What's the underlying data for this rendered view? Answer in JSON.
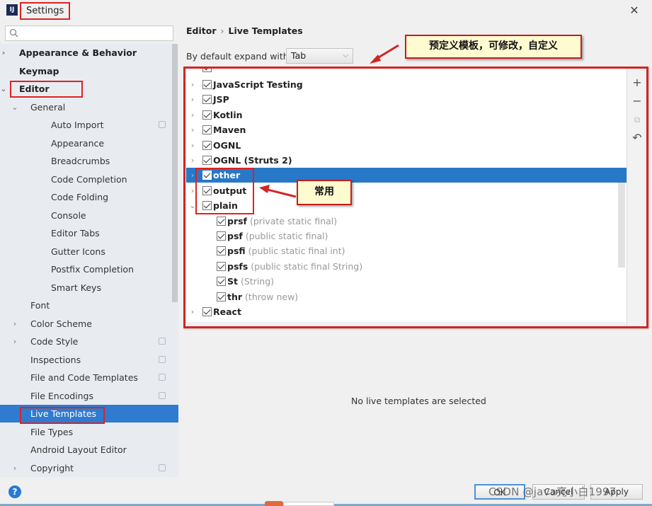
{
  "window": {
    "title": "Settings",
    "app_icon": "IJ",
    "close_icon": "close-icon"
  },
  "search": {
    "placeholder": "",
    "value": ""
  },
  "sidebar": {
    "items": [
      {
        "label": "Appearance & Behavior",
        "level": 0,
        "bold": true,
        "arrow": ">",
        "copy": false
      },
      {
        "label": "Keymap",
        "level": 0,
        "bold": true,
        "arrow": "",
        "copy": false
      },
      {
        "label": "Editor",
        "level": 0,
        "bold": true,
        "arrow": "v",
        "copy": false
      },
      {
        "label": "General",
        "level": 1,
        "bold": false,
        "arrow": "v",
        "copy": false
      },
      {
        "label": "Auto Import",
        "level": 2,
        "bold": false,
        "arrow": "",
        "copy": true
      },
      {
        "label": "Appearance",
        "level": 2,
        "bold": false,
        "arrow": "",
        "copy": false
      },
      {
        "label": "Breadcrumbs",
        "level": 2,
        "bold": false,
        "arrow": "",
        "copy": false
      },
      {
        "label": "Code Completion",
        "level": 2,
        "bold": false,
        "arrow": "",
        "copy": false
      },
      {
        "label": "Code Folding",
        "level": 2,
        "bold": false,
        "arrow": "",
        "copy": false
      },
      {
        "label": "Console",
        "level": 2,
        "bold": false,
        "arrow": "",
        "copy": false
      },
      {
        "label": "Editor Tabs",
        "level": 2,
        "bold": false,
        "arrow": "",
        "copy": false
      },
      {
        "label": "Gutter Icons",
        "level": 2,
        "bold": false,
        "arrow": "",
        "copy": false
      },
      {
        "label": "Postfix Completion",
        "level": 2,
        "bold": false,
        "arrow": "",
        "copy": false
      },
      {
        "label": "Smart Keys",
        "level": 2,
        "bold": false,
        "arrow": "",
        "copy": false
      },
      {
        "label": "Font",
        "level": 1,
        "bold": false,
        "arrow": "",
        "copy": false
      },
      {
        "label": "Color Scheme",
        "level": 1,
        "bold": false,
        "arrow": ">",
        "copy": false
      },
      {
        "label": "Code Style",
        "level": 1,
        "bold": false,
        "arrow": ">",
        "copy": true
      },
      {
        "label": "Inspections",
        "level": 1,
        "bold": false,
        "arrow": "",
        "copy": true
      },
      {
        "label": "File and Code Templates",
        "level": 1,
        "bold": false,
        "arrow": "",
        "copy": true
      },
      {
        "label": "File Encodings",
        "level": 1,
        "bold": false,
        "arrow": "",
        "copy": true
      },
      {
        "label": "Live Templates",
        "level": 1,
        "bold": false,
        "arrow": "",
        "copy": false,
        "selected": true
      },
      {
        "label": "File Types",
        "level": 1,
        "bold": false,
        "arrow": "",
        "copy": false
      },
      {
        "label": "Android Layout Editor",
        "level": 1,
        "bold": false,
        "arrow": "",
        "copy": false
      },
      {
        "label": "Copyright",
        "level": 1,
        "bold": false,
        "arrow": ">",
        "copy": true
      }
    ]
  },
  "main": {
    "breadcrumb": [
      "Editor",
      "Live Templates"
    ],
    "breadcrumb_sep": "›",
    "expand_label": "By default expand with",
    "expand_value": "Tab",
    "tree": [
      {
        "label": "JavaScript Testing",
        "desc": "",
        "level": 0,
        "arrow": ">",
        "checked": true
      },
      {
        "label": "JSP",
        "desc": "",
        "level": 0,
        "arrow": ">",
        "checked": true
      },
      {
        "label": "Kotlin",
        "desc": "",
        "level": 0,
        "arrow": ">",
        "checked": true
      },
      {
        "label": "Maven",
        "desc": "",
        "level": 0,
        "arrow": ">",
        "checked": true
      },
      {
        "label": "OGNL",
        "desc": "",
        "level": 0,
        "arrow": ">",
        "checked": true
      },
      {
        "label": "OGNL (Struts 2)",
        "desc": "",
        "level": 0,
        "arrow": ">",
        "checked": true
      },
      {
        "label": "other",
        "desc": "",
        "level": 0,
        "arrow": ">",
        "checked": true,
        "selected": true
      },
      {
        "label": "output",
        "desc": "",
        "level": 0,
        "arrow": ">",
        "checked": true
      },
      {
        "label": "plain",
        "desc": "",
        "level": 0,
        "arrow": "v",
        "checked": true
      },
      {
        "label": "prsf",
        "desc": "(private static final)",
        "level": 1,
        "arrow": "",
        "checked": true
      },
      {
        "label": "psf",
        "desc": "(public static final)",
        "level": 1,
        "arrow": "",
        "checked": true
      },
      {
        "label": "psfi",
        "desc": "(public static final int)",
        "level": 1,
        "arrow": "",
        "checked": true
      },
      {
        "label": "psfs",
        "desc": "(public static final String)",
        "level": 1,
        "arrow": "",
        "checked": true
      },
      {
        "label": "St",
        "desc": "(String)",
        "level": 1,
        "arrow": "",
        "checked": true
      },
      {
        "label": "thr",
        "desc": "(throw new)",
        "level": 1,
        "arrow": "",
        "checked": true
      },
      {
        "label": "React",
        "desc": "",
        "level": 0,
        "arrow": ">",
        "checked": true
      }
    ],
    "toolbar": {
      "add": "+",
      "remove": "−",
      "copy": "⧉",
      "restore": "↶"
    },
    "empty_message": "No live templates are selected"
  },
  "annotations": {
    "predefined": "预定义模板，可修改，自定义",
    "common": "常用",
    "annotation_color": "#d42424",
    "callout_bg": "#fffbd0"
  },
  "footer": {
    "help": "?",
    "buttons": [
      "OK",
      "Cancel",
      "Apply"
    ],
    "watermark": "CSDN @java亮小白1997"
  },
  "colors": {
    "selection": "#2e7bd0",
    "sidebar_bg": "#e8ecf1"
  }
}
